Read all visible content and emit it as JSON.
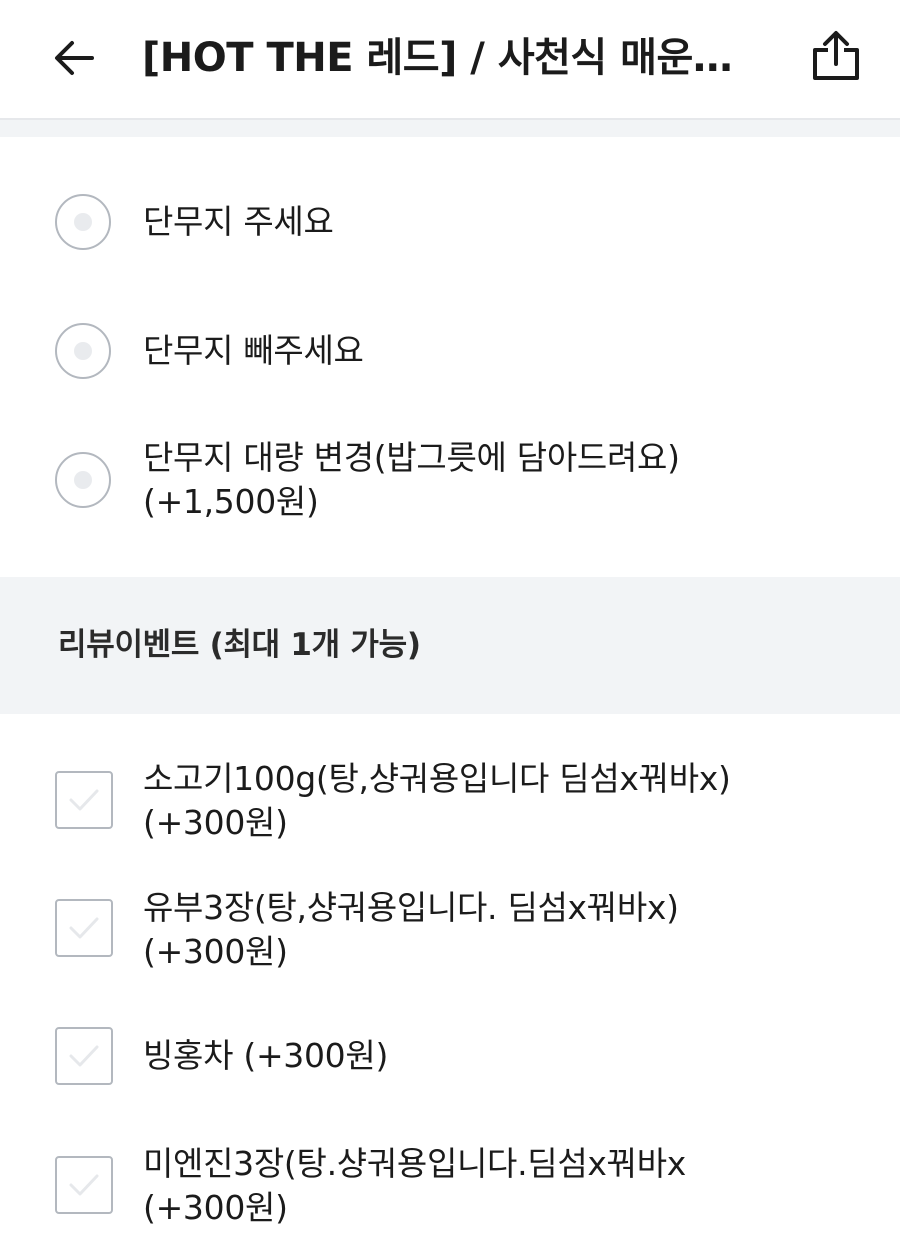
{
  "header": {
    "title": "[HOT THE 레드] / 사천식 매운…",
    "back_icon": "arrow-left-icon",
    "share_icon": "share-icon"
  },
  "radio_options": [
    {
      "label": "단무지 주세요",
      "price": ""
    },
    {
      "label": "단무지 빼주세요",
      "price": ""
    },
    {
      "label": "단무지 대량 변경(밥그릇에 담아드려요)",
      "price": "(+1,500원)"
    }
  ],
  "review_section": {
    "title": "리뷰이벤트 (최대 1개 가능)",
    "options": [
      {
        "label": "소고기100g(탕,샹궈용입니다 딤섬x꿔바x)",
        "price": "(+300원)"
      },
      {
        "label": "유부3장(탕,샹궈용입니다. 딤섬x꿔바x)",
        "price": "(+300원)"
      },
      {
        "label": "빙홍차 (+300원)",
        "price": ""
      },
      {
        "label": "미엔진3장(탕.샹궈용입니다.딤섬x꿔바x",
        "price": "(+300원)"
      }
    ]
  },
  "colors": {
    "text": "#1b1b1b",
    "border": "#b3b8bf",
    "section_bg": "#f2f4f6"
  }
}
